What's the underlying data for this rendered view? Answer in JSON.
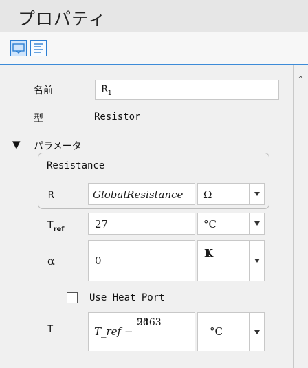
{
  "title": "プロパティ",
  "toolbar": {
    "icons": [
      "properties-view-icon",
      "text-view-icon"
    ]
  },
  "fields": {
    "name_label": "名前",
    "name_value": "R",
    "name_subscript": "1",
    "type_label": "型",
    "type_value": "Resistor"
  },
  "parameters": {
    "section_label": "パラメータ",
    "resistance_group_label": "Resistance",
    "R": {
      "label": "R",
      "value": "GlobalResistance",
      "unit": "Ω"
    },
    "Tref": {
      "label_main": "T",
      "label_sub": "ref",
      "value": "27",
      "unit": "°C"
    },
    "alpha": {
      "label": "α",
      "value": "0",
      "unit_num": "1",
      "unit_den": "K"
    },
    "use_heat_port_label": "Use Heat Port",
    "use_heat_port_checked": false,
    "T": {
      "label": "T",
      "value_prefix": "T_ref",
      "value_op": "−",
      "value_num": "5463",
      "value_den": "20",
      "unit": "°C"
    }
  }
}
